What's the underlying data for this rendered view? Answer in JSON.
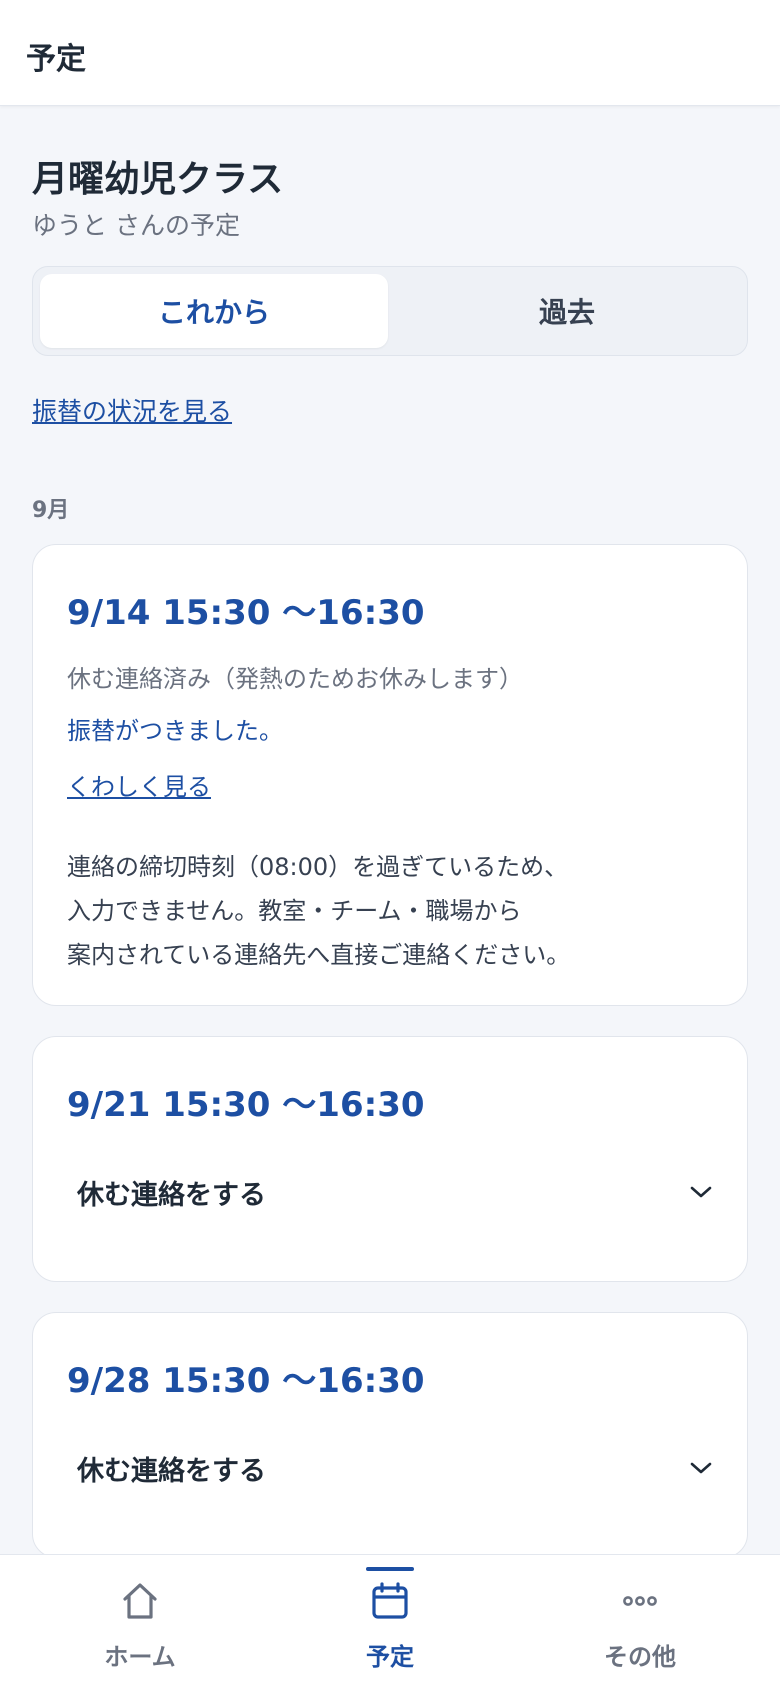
{
  "header": {
    "title": "予定"
  },
  "class_info": {
    "name": "月曜幼児クラス",
    "subtitle": "ゆうと さんの予定"
  },
  "tabs": [
    {
      "label": "これから",
      "active": true
    },
    {
      "label": "過去",
      "active": false
    }
  ],
  "transfer_status_link": "振替の状況を見る",
  "month_label": "9月",
  "schedules": [
    {
      "date_time": "9/14 15:30 〜16:30",
      "status": "休む連絡済み（発熱のためお休みします）",
      "transfer_message": "振替がつきました。",
      "details_link": "くわしく見る",
      "notice_lines": [
        "連絡の締切時刻（08:00）を過ぎているため、",
        "入力できません。教室・チーム・職場から",
        "案内されている連絡先へ直接ご連絡ください。"
      ]
    },
    {
      "date_time": "9/21 15:30 〜16:30",
      "action_label": "休む連絡をする"
    },
    {
      "date_time": "9/28 15:30 〜16:30",
      "action_label": "休む連絡をする"
    }
  ],
  "bottom_nav": [
    {
      "label": "ホーム",
      "icon": "home-icon",
      "active": false
    },
    {
      "label": "予定",
      "icon": "calendar-icon",
      "active": true
    },
    {
      "label": "その他",
      "icon": "more-icon",
      "active": false
    }
  ],
  "colors": {
    "accent": "#1d4fa3",
    "muted": "#6b7280",
    "background": "#f4f6fa",
    "card": "#ffffff"
  }
}
